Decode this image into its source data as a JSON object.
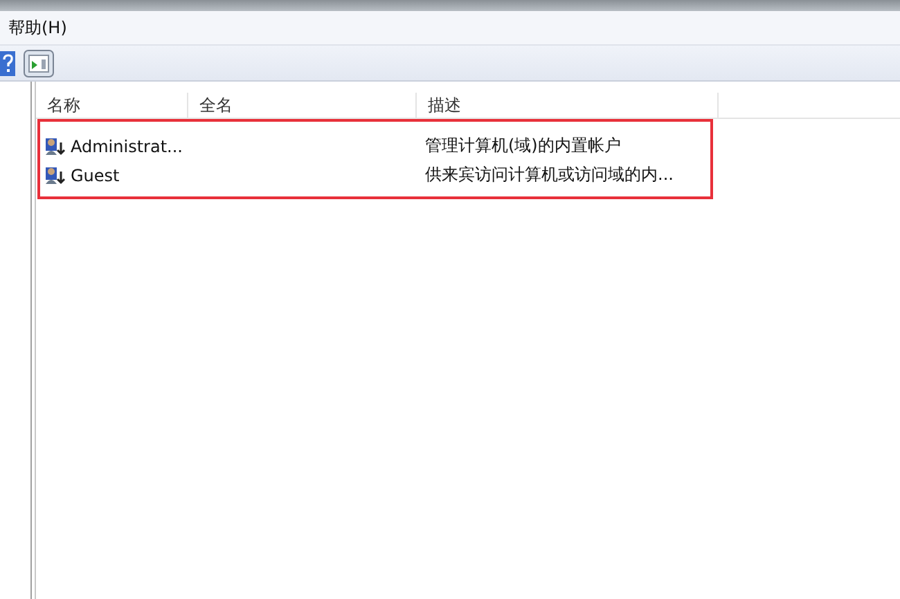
{
  "menu_bar": {
    "items": [
      "帮助(H)"
    ]
  },
  "list": {
    "columns": [
      "名称",
      "全名",
      "描述"
    ],
    "rows": [
      {
        "name": "Administrat...",
        "full_name": "",
        "description": "管理计算机(域)的内置帐户"
      },
      {
        "name": "Guest",
        "full_name": "",
        "description": "供来宾访问计算机或访问域的内..."
      }
    ],
    "highlighted": true
  }
}
